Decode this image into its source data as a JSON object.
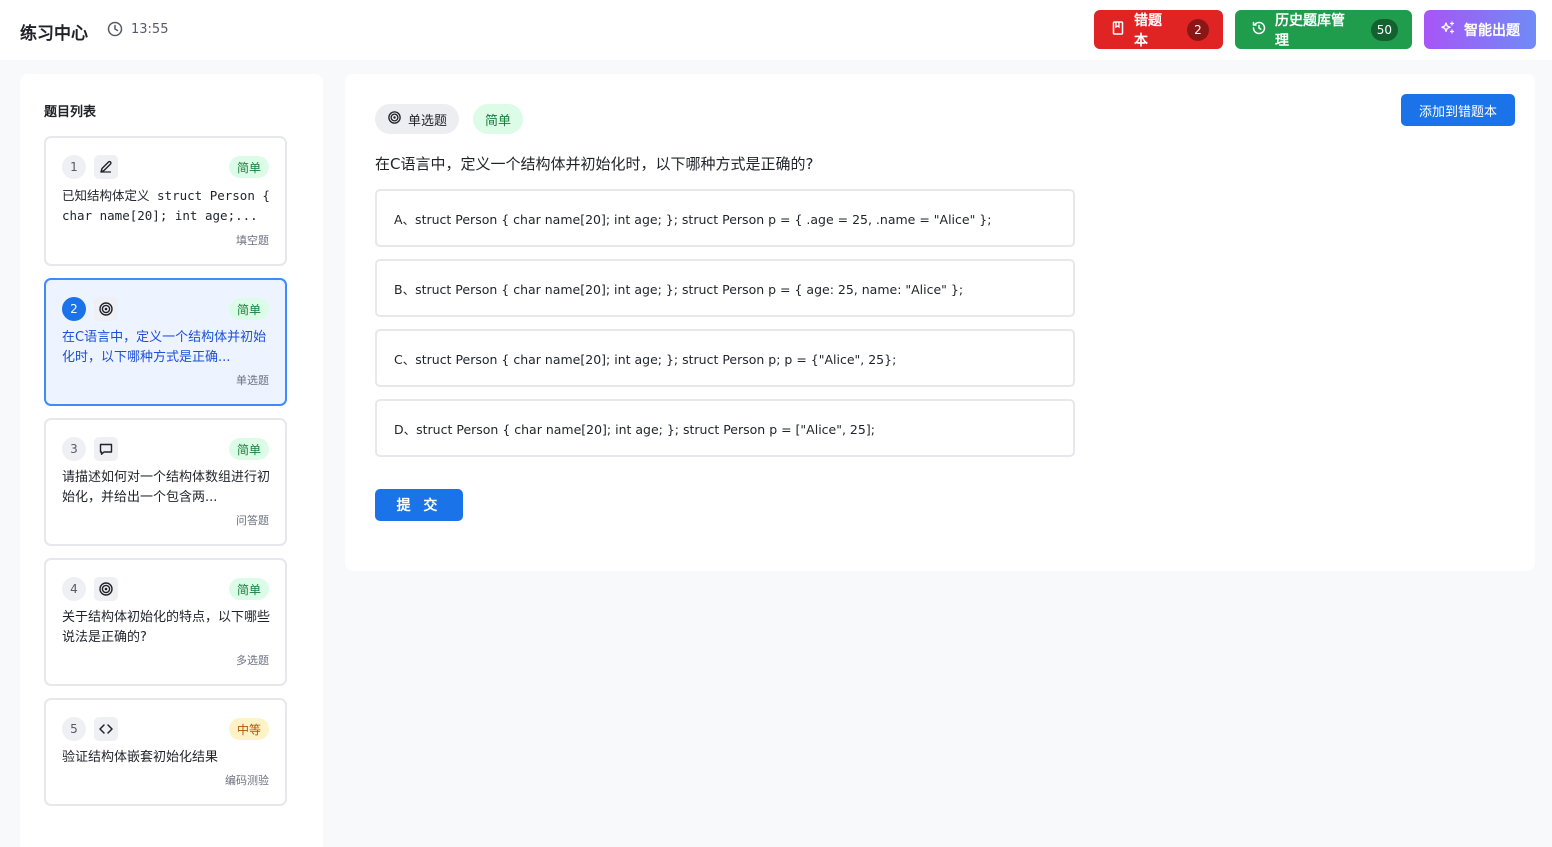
{
  "header": {
    "title": "练习中心",
    "time": "13:55",
    "buttons": {
      "wrong_book": {
        "label": "错题本",
        "count": "2",
        "icon": "notebook-icon",
        "color": "#e02424"
      },
      "history": {
        "label": "历史题库管理",
        "count": "50",
        "icon": "history-icon",
        "color": "#1f9d4d"
      },
      "ai": {
        "label": "智能出题",
        "icon": "sparkles-icon"
      }
    }
  },
  "sidebar": {
    "title": "题目列表",
    "items": [
      {
        "num": "1",
        "icon": "pencil-icon",
        "difficulty": "简单",
        "text": "已知结构体定义 struct Person { char name[20]; int age;...",
        "type": "填空题"
      },
      {
        "num": "2",
        "icon": "target-icon",
        "difficulty": "简单",
        "text": "在C语言中，定义一个结构体并初始化时，以下哪种方式是正确...",
        "type": "单选题",
        "active": true
      },
      {
        "num": "3",
        "icon": "chat-icon",
        "difficulty": "简单",
        "text": "请描述如何对一个结构体数组进行初始化，并给出一个包含两...",
        "type": "问答题"
      },
      {
        "num": "4",
        "icon": "target-icon",
        "difficulty": "简单",
        "text": "关于结构体初始化的特点，以下哪些说法是正确的?",
        "type": "多选题"
      },
      {
        "num": "5",
        "icon": "code-icon",
        "difficulty": "中等",
        "text": "验证结构体嵌套初始化结果",
        "type": "编码测验"
      }
    ]
  },
  "main": {
    "type_label": "单选题",
    "difficulty": "简单",
    "add_wrong_label": "添加到错题本",
    "question": "在C语言中，定义一个结构体并初始化时，以下哪种方式是正确的?",
    "options": [
      "A、struct Person { char name[20]; int age; }; struct Person p = { .age = 25, .name = \"Alice\" };",
      "B、struct Person { char name[20]; int age; }; struct Person p = { age: 25, name: \"Alice\" };",
      "C、struct Person { char name[20]; int age; }; struct Person p; p = {\"Alice\", 25};",
      "D、struct Person { char name[20]; int age; }; struct Person p = [\"Alice\", 25];"
    ],
    "submit_label": "提 交"
  }
}
